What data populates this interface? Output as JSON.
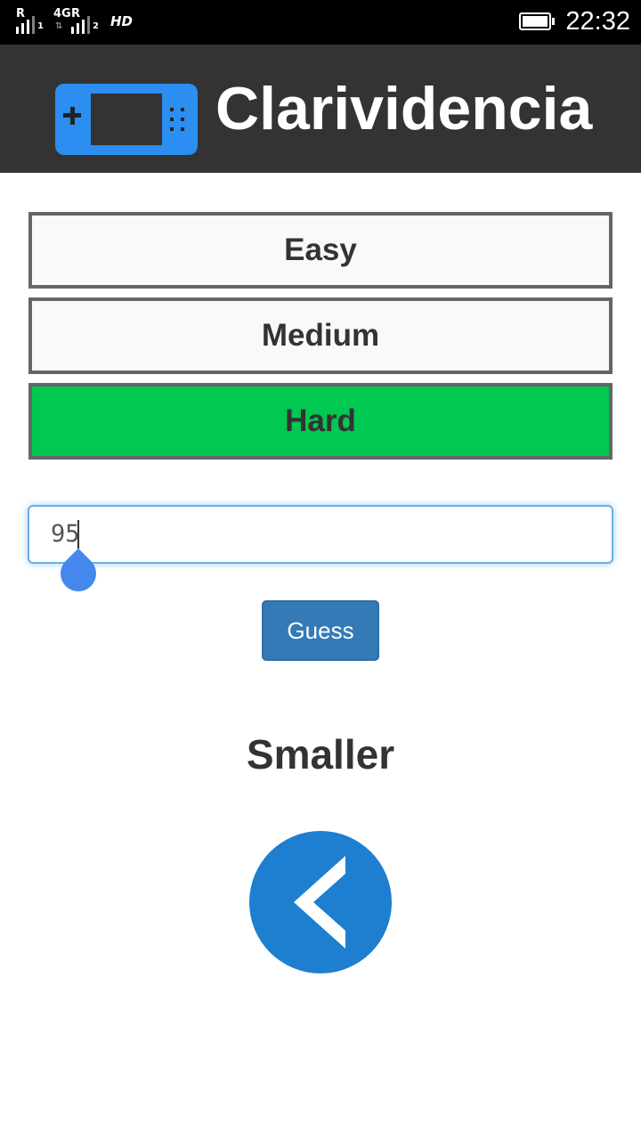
{
  "status_bar": {
    "sim1_letter": "R",
    "sim1_index": "1",
    "network_type": "4G",
    "sim2_letter": "R",
    "sim2_index": "2",
    "hd_label": "HD",
    "time": "22:32"
  },
  "header": {
    "title": "Clarividencia",
    "logo_icon": "gamepad-icon",
    "background": "#333333",
    "logo_color": "#2b8ef0"
  },
  "difficulty": {
    "options": [
      {
        "label": "Easy",
        "selected": false
      },
      {
        "label": "Medium",
        "selected": false
      },
      {
        "label": "Hard",
        "selected": true
      }
    ],
    "selected_color": "#00c851"
  },
  "guess": {
    "input_value": "95",
    "button_label": "Guess",
    "button_color": "#337ab7"
  },
  "result": {
    "text": "Smaller",
    "icon": "chevron-left-icon",
    "icon_color": "#1e7fd0"
  }
}
